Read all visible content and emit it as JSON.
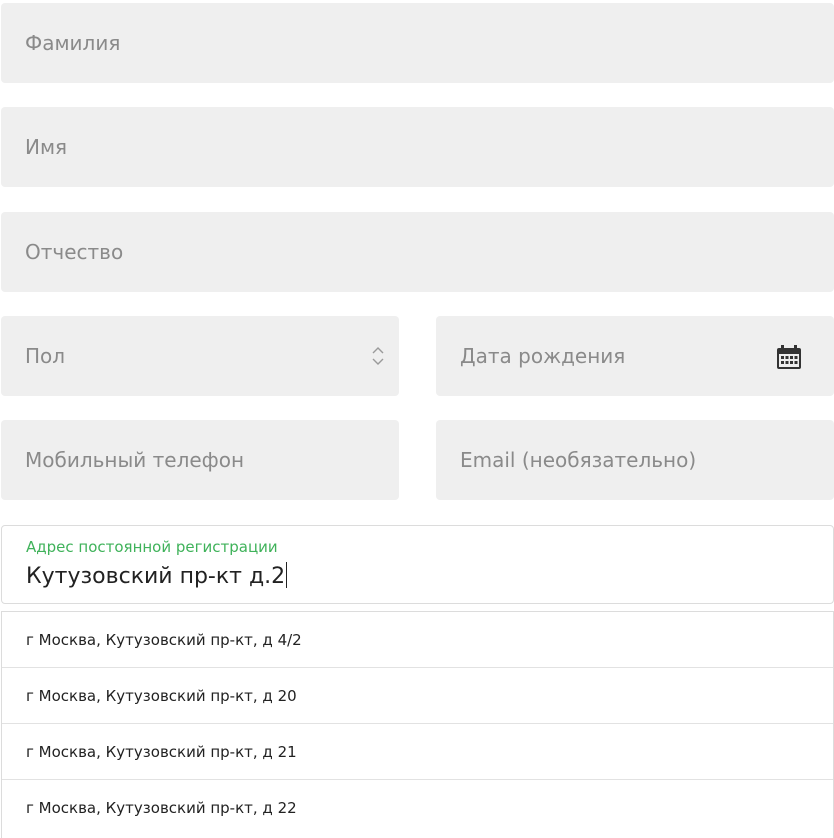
{
  "form": {
    "surname_placeholder": "Фамилия",
    "name_placeholder": "Имя",
    "patronymic_placeholder": "Отчество",
    "gender_placeholder": "Пол",
    "birthdate_placeholder": "Дата рождения",
    "mobile_placeholder": "Мобильный телефон",
    "email_placeholder": "Email (необязательно)",
    "address": {
      "label": "Адрес постоянной регистрации",
      "value": "Кутузовский пр-кт д.2"
    }
  },
  "suggestions": [
    "г Москва, Кутузовский пр-кт, д 4/2",
    "г Москва, Кутузовский пр-кт, д 20",
    "г Москва, Кутузовский пр-кт, д 21",
    "г Москва, Кутузовский пр-кт, д 22"
  ],
  "colors": {
    "field_bg": "#efefef",
    "placeholder": "#8a8a8a",
    "label_accent": "#3fb25a",
    "icon": "#333333"
  },
  "icons": {
    "gender_select": "sort-updown-icon",
    "birthdate": "calendar-icon"
  }
}
